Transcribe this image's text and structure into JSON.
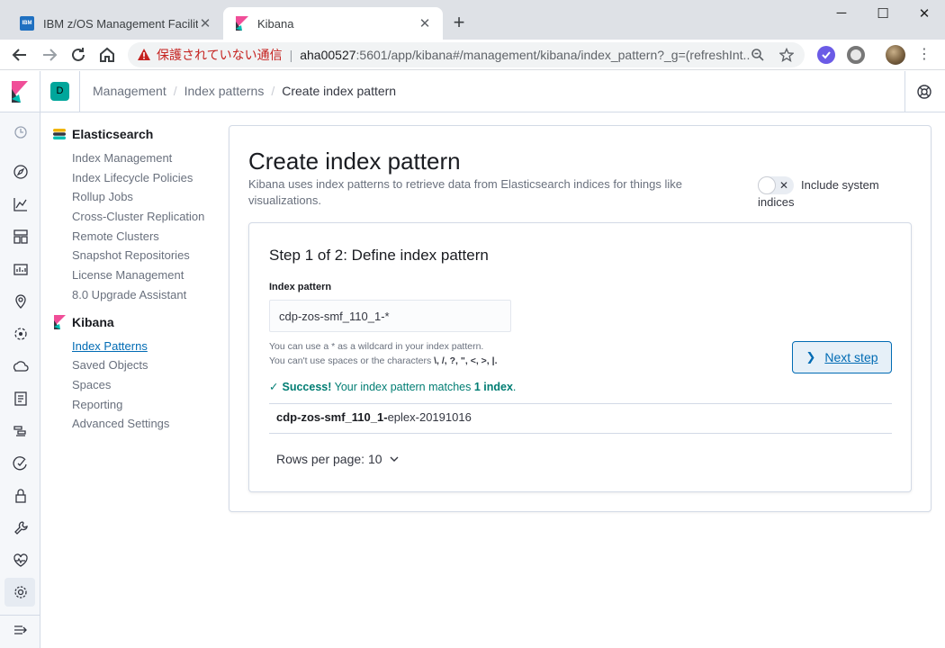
{
  "browser": {
    "tabs": [
      {
        "label": "IBM z/OS Management Facility on",
        "favicon": "IBM"
      },
      {
        "label": "Kibana"
      }
    ],
    "window_controls": {
      "minimize": "─",
      "maximize": "☐",
      "close": "✕"
    },
    "omnibox": {
      "insecure_label": "保護されていない通信",
      "host": "aha00527",
      "rest": ":5601/app/kibana#/management/kibana/index_pattern?_g=(refreshInt..."
    }
  },
  "header": {
    "space_initial": "D",
    "breadcrumbs": [
      "Management",
      "Index patterns",
      "Create index pattern"
    ]
  },
  "sidenav": {
    "elasticsearch": {
      "title": "Elasticsearch",
      "items": [
        "Index Management",
        "Index Lifecycle Policies",
        "Rollup Jobs",
        "Cross-Cluster Replication",
        "Remote Clusters",
        "Snapshot Repositories",
        "License Management",
        "8.0 Upgrade Assistant"
      ]
    },
    "kibana": {
      "title": "Kibana",
      "items": [
        "Index Patterns",
        "Saved Objects",
        "Spaces",
        "Reporting",
        "Advanced Settings"
      ]
    }
  },
  "main": {
    "title": "Create index pattern",
    "description": "Kibana uses index patterns to retrieve data from Elasticsearch indices for things like visualizations.",
    "system_toggle": {
      "label_line1": "Include system",
      "label_line2": "indices",
      "enabled": false
    },
    "step": {
      "title": "Step 1 of 2: Define index pattern",
      "field_label": "Index pattern",
      "input_value": "cdp-zos-smf_110_1-*",
      "help_line1": "You can use a * as a wildcard in your index pattern.",
      "help_line2_prefix": "You can't use spaces or the characters ",
      "help_line2_chars": "\\, /, ?, \", <, >, |.",
      "next_button": "Next step",
      "success_strong": "Success!",
      "success_text": " Your index pattern matches ",
      "success_count": "1 index",
      "success_end": ".",
      "match_bold": "cdp-zos-smf_110_1-",
      "match_rest": "eplex-20191016",
      "rows_per_page": "Rows per page: 10"
    }
  },
  "colors": {
    "accent": "#006bb4",
    "success": "#017d73",
    "space_badge": "#00a69b",
    "insecure": "#c5221f"
  },
  "icons": {
    "rail": [
      "clock-icon",
      "compass-icon",
      "visualize-icon",
      "dashboard-icon",
      "canvas-icon",
      "maps-icon",
      "ml-icon",
      "infrastructure-icon",
      "logs-icon",
      "apm-icon",
      "uptime-icon",
      "siem-icon",
      "dev-tools-icon",
      "monitoring-icon",
      "management-gear-icon",
      "collapse-icon"
    ]
  }
}
